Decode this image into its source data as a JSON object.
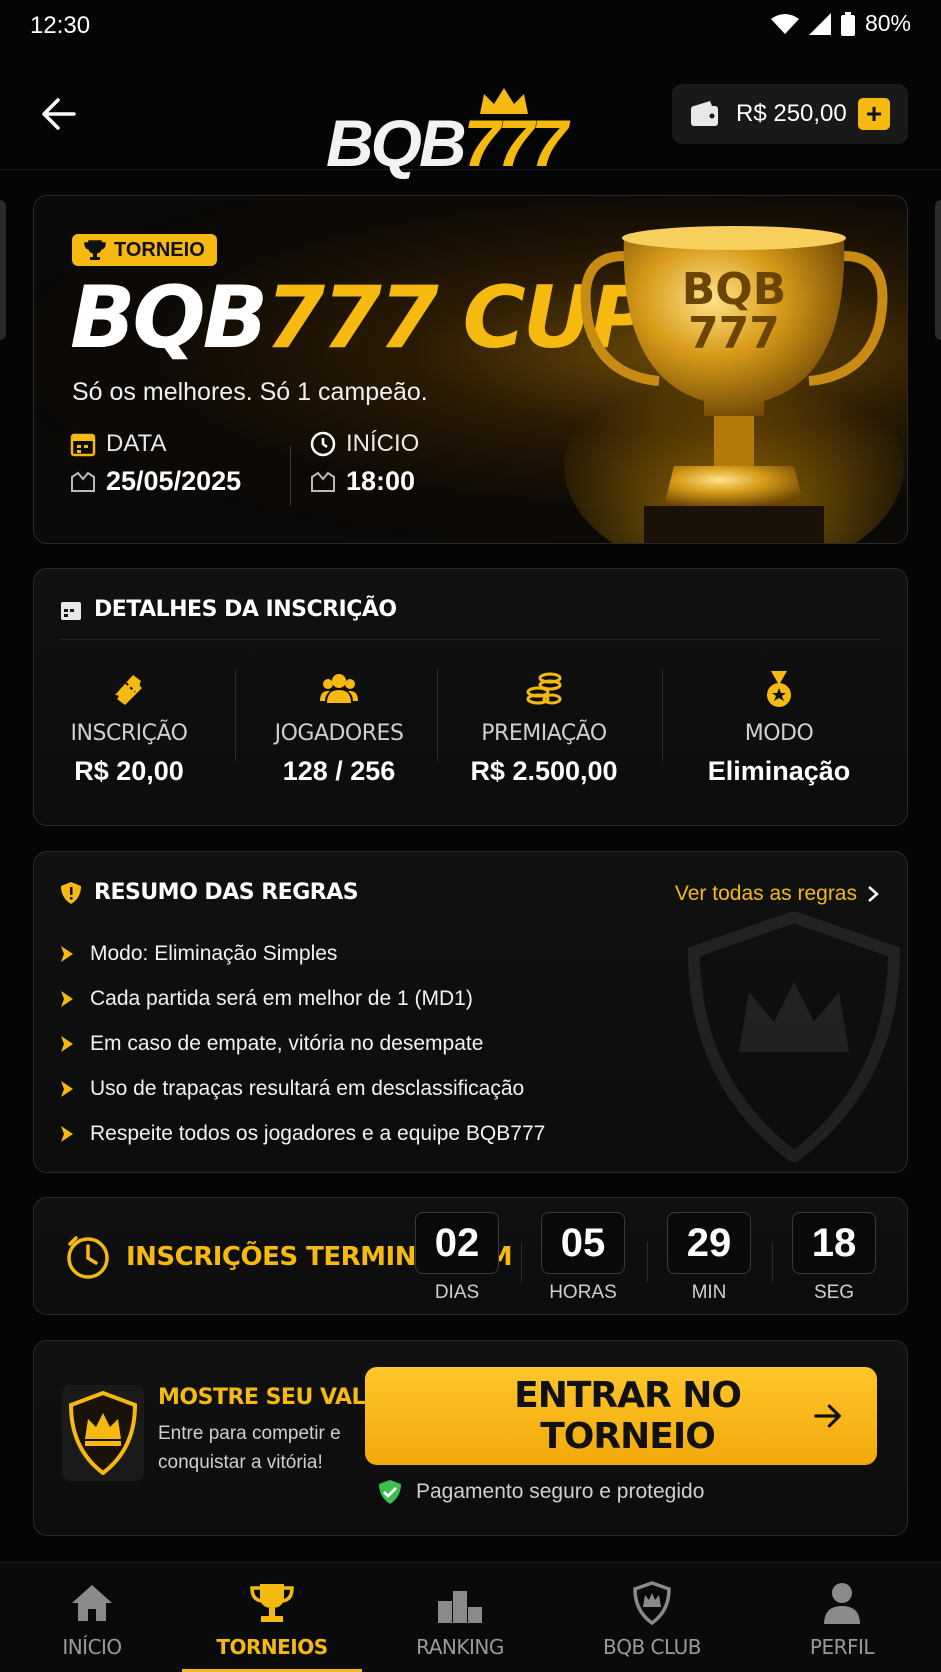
{
  "status_bar": {
    "time": "12:30",
    "battery": "80%"
  },
  "header": {
    "logo_text": "BQB777",
    "balance": "R$ 250,00",
    "add_label": "+"
  },
  "hero": {
    "badge": "TORNEIO",
    "title_white": "BQB",
    "title_gold": "777 CUP",
    "subtitle": "Só os melhores. Só 1 campeão.",
    "date_label": "DATA",
    "date_value": "25/05/2025",
    "start_label": "INÍCIO",
    "start_value": "18:00",
    "trophy_text_1": "BQB",
    "trophy_text_2": "777"
  },
  "details": {
    "title": "DETALHES DA INSCRIÇÃO",
    "stats": [
      {
        "label": "INSCRIÇÃO",
        "value": "R$ 20,00",
        "icon": "ticket-icon"
      },
      {
        "label": "JOGADORES",
        "value": "128 / 256",
        "icon": "players-icon"
      },
      {
        "label": "PREMIAÇÃO",
        "value": "R$ 2.500,00",
        "icon": "coins-icon"
      },
      {
        "label": "MODO",
        "value": "Eliminação",
        "icon": "medal-icon"
      }
    ]
  },
  "rules": {
    "title": "RESUMO DAS REGRAS",
    "link": "Ver todas as regras",
    "items": [
      "Modo: Eliminação Simples",
      "Cada partida será em melhor de 1 (MD1)",
      "Em caso de empate, vitória no desempate",
      "Uso de trapaças resultará em desclassificação",
      "Respeite todos os jogadores e a equipe BQB777"
    ]
  },
  "countdown": {
    "label": "INSCRIÇÕES TERMINAM EM",
    "units": [
      {
        "value": "02",
        "label": "DIAS"
      },
      {
        "value": "05",
        "label": "HORAS"
      },
      {
        "value": "29",
        "label": "MIN"
      },
      {
        "value": "18",
        "label": "SEG"
      }
    ]
  },
  "cta": {
    "title": "MOSTRE SEU VALOR",
    "description": "Entre para competir e conquistar a vitória!",
    "button": "ENTRAR NO TORNEIO",
    "secure": "Pagamento seguro e protegido"
  },
  "nav": {
    "items": [
      {
        "label": "INÍCIO",
        "icon": "home-icon"
      },
      {
        "label": "TORNEIOS",
        "icon": "trophy-icon",
        "active": true
      },
      {
        "label": "RANKING",
        "icon": "podium-icon"
      },
      {
        "label": "BQB CLUB",
        "icon": "club-shield-icon"
      },
      {
        "label": "PERFIL",
        "icon": "user-icon"
      }
    ]
  },
  "colors": {
    "accent": "#f5b90f",
    "background": "#050505",
    "card": "#0f0f0f",
    "secure_green": "#3fbf4f"
  }
}
